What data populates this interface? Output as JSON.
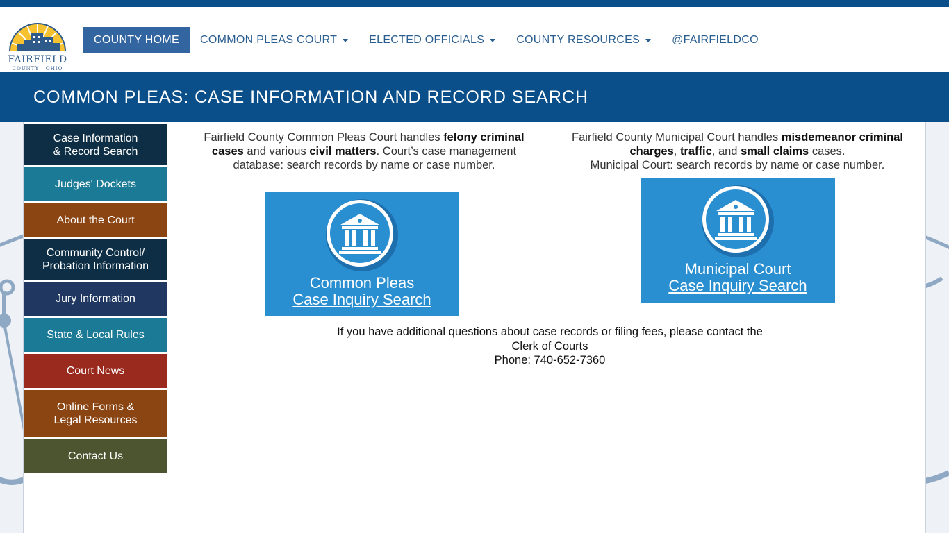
{
  "logo": {
    "name": "FAIRFIELD",
    "sub": "COUNTY · OHIO"
  },
  "nav": [
    {
      "label": "COUNTY HOME",
      "dropdown": false,
      "active": true
    },
    {
      "label": "COMMON PLEAS COURT",
      "dropdown": true,
      "active": false
    },
    {
      "label": "ELECTED OFFICIALS",
      "dropdown": true,
      "active": false
    },
    {
      "label": "COUNTY RESOURCES",
      "dropdown": true,
      "active": false
    },
    {
      "label": "@FAIRFIELDCO",
      "dropdown": false,
      "active": false
    }
  ],
  "page_title": "COMMON PLEAS: CASE INFORMATION AND RECORD SEARCH",
  "sidebar": [
    {
      "line1": "Case Information",
      "line2": "& Record Search",
      "color": "#0e2e45"
    },
    {
      "line1": "Judges' Dockets",
      "line2": "",
      "color": "#1b7a95"
    },
    {
      "line1": "About the Court",
      "line2": "",
      "color": "#8b4513"
    },
    {
      "line1": "Community Control/",
      "line2": "Probation Information",
      "color": "#0e2e45"
    },
    {
      "line1": "Jury Information",
      "line2": "",
      "color": "#1f3761"
    },
    {
      "line1": "State & Local Rules",
      "line2": "",
      "color": "#1b7a95"
    },
    {
      "line1": "Court News",
      "line2": "",
      "color": "#9a2a1e"
    },
    {
      "line1": "Online Forms &",
      "line2": "Legal Resources",
      "color": "#8b4513"
    },
    {
      "line1": "Contact Us",
      "line2": "",
      "color": "#4d5530"
    }
  ],
  "common_pleas": {
    "t1": "Fairfield County Common Pleas Court handles ",
    "b1": "felony criminal cases",
    "t2": " and various ",
    "b2": "civil matters",
    "t3": ".  Court’s case management database: search records by name or case number.",
    "button_line1": "Common Pleas",
    "button_line2": "Case Inquiry Search"
  },
  "municipal": {
    "t1": "Fairfield County Municipal Court handles ",
    "b1": "misdemeanor criminal charges",
    "t2": ", ",
    "b2": "traffic",
    "t3": ", and ",
    "b3": "small claims",
    "t4": " cases.",
    "line2": "Municipal Court: search records by name or case number.",
    "button_line1": "Municipal Court",
    "button_line2": "Case Inquiry Search"
  },
  "contact": {
    "line1": "If you have additional questions about case records or filing fees, please contact the",
    "line2": "Clerk of Courts",
    "line3": "Phone: 740-652-7360"
  },
  "colors": {
    "brand_blue": "#0a4f8a",
    "nav_active": "#3366a0",
    "button_blue": "#2a8fd0"
  }
}
